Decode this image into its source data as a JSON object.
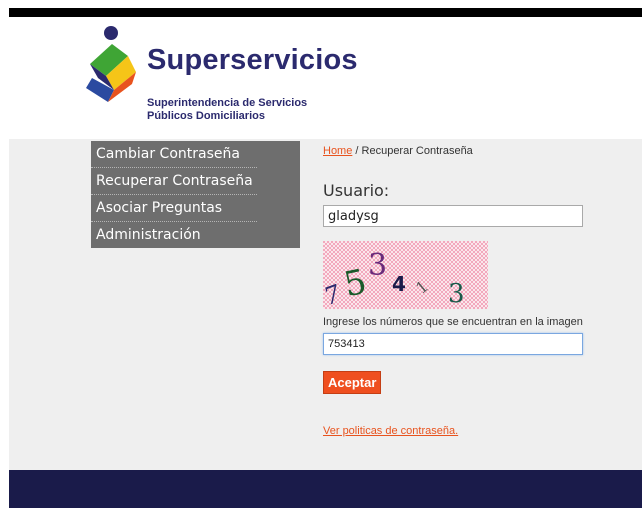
{
  "header": {
    "brand_name": "Superservicios",
    "brand_sub_1": "Superintendencia de Servicios",
    "brand_sub_2": "Públicos Domiciliarios"
  },
  "nav": {
    "items": [
      {
        "label": "Cambiar Contraseña"
      },
      {
        "label": "Recuperar Contraseña"
      },
      {
        "label": "Asociar Preguntas"
      },
      {
        "label": "Administración"
      }
    ]
  },
  "breadcrumb": {
    "home": "Home",
    "separator": " / ",
    "current": "Recuperar Contraseña"
  },
  "form": {
    "user_label": "Usuario:",
    "user_value": "gladysg",
    "captcha_text": "753413",
    "captcha_label": "Ingrese los números que se encuentran en la imagen",
    "captcha_value": "753413",
    "submit_label": "Aceptar",
    "policy_link": "Ver politicas de contraseña."
  },
  "colors": {
    "nav_bg": "#6e6e6e",
    "accent": "#ef4f1f",
    "brand": "#2b2a6e",
    "footer": "#1a1b4a"
  }
}
